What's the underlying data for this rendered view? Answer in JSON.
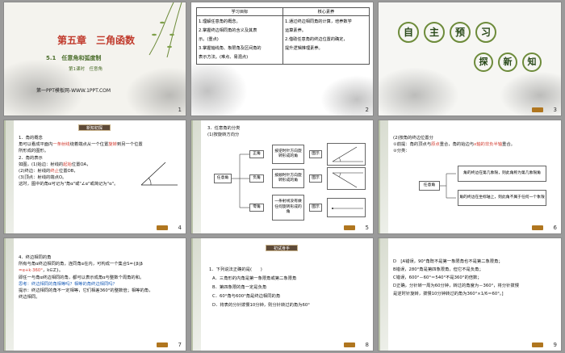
{
  "s1": {
    "chapter": "第五章　三角函数",
    "section": "5.1　任意角和弧度制",
    "lesson": "第1课时　任意角",
    "watermark": "第一PPT模板网-WWW.1PPT.COM",
    "num": "1"
  },
  "s2": {
    "col1": "学习目标",
    "col2": "核心素养",
    "goals": [
      "1.理解任意角的概念。",
      "2.掌握终边相同角的含义及其表",
      "示。(重点)",
      "3.掌握轴线角、象限角及区间角的",
      "表示方法。(难点、易混点)"
    ],
    "core": [
      "1.通过终边相同角的计算，培养数学",
      "运算素养。",
      "2.借助任意角的终边位置的确定，",
      "提升逻辑推理素养。"
    ],
    "num": "2"
  },
  "s3": {
    "chars": [
      "自",
      "主",
      "预",
      "习"
    ],
    "sub": [
      "探",
      "新",
      "知"
    ],
    "num": "3"
  },
  "s4": {
    "badge": "新知初探",
    "l1": "1．角的概念",
    "l2a": "角可以看成平面内",
    "l2b": "一条射线",
    "l2c": "绕着端点从一个位置",
    "l2d": "旋转",
    "l2e": "到另一个位置",
    "l3": "所形成的图形。",
    "l4": "2．角的表示",
    "l5a": "如图，(1)始边：射线的",
    "l5b": "起始",
    "l5c": "位置OA，",
    "l6a": "(2)终边：射线的",
    "l6b": "终止",
    "l6c": "位置OB，",
    "l7": "(3)顶点：射线的端点O。",
    "l8": "这时，图中的角α可记为\"角α\"或\"∠α\"或简记为\"α\"。",
    "num": "4"
  },
  "s5": {
    "title": "3．任意角的分类",
    "sub": "(1)按旋转方向分",
    "root": "任意角",
    "types": [
      "正角",
      "负角",
      "零角"
    ],
    "desc": [
      "按逆时针方向旋转形成的角",
      "按顺时针方向旋转形成的角",
      "一条射线没有做任何旋转形成的角"
    ],
    "pic": [
      "图示",
      "图示",
      "图示"
    ],
    "num": "5"
  },
  "s6": {
    "l1": "(2)按角的终边位置分",
    "l2a": "①前提：角的顶点与",
    "l2b": "原点",
    "l2c": "重合，角的始边与",
    "l2d": "x轴的非负半轴",
    "l2e": "重合。",
    "l3": "②分类：",
    "root": "任意角",
    "a1": "角的终边在第几象限，则此角称为第几象限角",
    "a2": "角的终边在坐标轴上，则此角不属于任何一个象限",
    "num": "6"
  },
  "s7": {
    "l1": "4．终边相同的角",
    "l2": "所有与角α终边相同的角，连同角α在内，可构成一个集合S={β|β",
    "l3a": "=α+k·360°",
    "l3b": "，k∈Z}。",
    "l4": "即任一与角α终边相同的角，都可以表示成角α与整数个周角的和。",
    "l5": "思考：终边相同的角相等吗？相等的角终边相同吗？",
    "l6": "提示：终边相同的角不一定相等，它们相差360°的整数倍；相等的角，",
    "l7": "终边相同。",
    "num": "7"
  },
  "s8": {
    "badge": "初试身手",
    "q": "1．下列说法正确的是(　　)",
    "opts": [
      "A．三角形的内角是第一象限角或第二象限角",
      "B．第四象限的角一定是负角",
      "C．60°角与600°角是终边相同的角",
      "D．将表的分针拨慢10分钟，则分针转过的角为60°"
    ],
    "num": "8"
  },
  "s9": {
    "a1": "D　[A错误，90°角既不是第一象限角也不是第二象限角；",
    "a2": "B错误，280°角是第四象限角，但它不是负角；",
    "a3": "C错误，600°－60°＝540°不是360°的倍数；",
    "a4": "D正确，分针转一周为60分钟，转过的角度为－360°，将分针拨慢",
    "a5": "是逆时针旋转，拨慢10分钟转过的角为360°×1/6＝60°。]",
    "num": "9"
  },
  "colors": {
    "title_red": "#d23a2e",
    "accent_blue": "#1d5fb8",
    "dark_band": "#5e4a38",
    "button": "#b0761f"
  }
}
